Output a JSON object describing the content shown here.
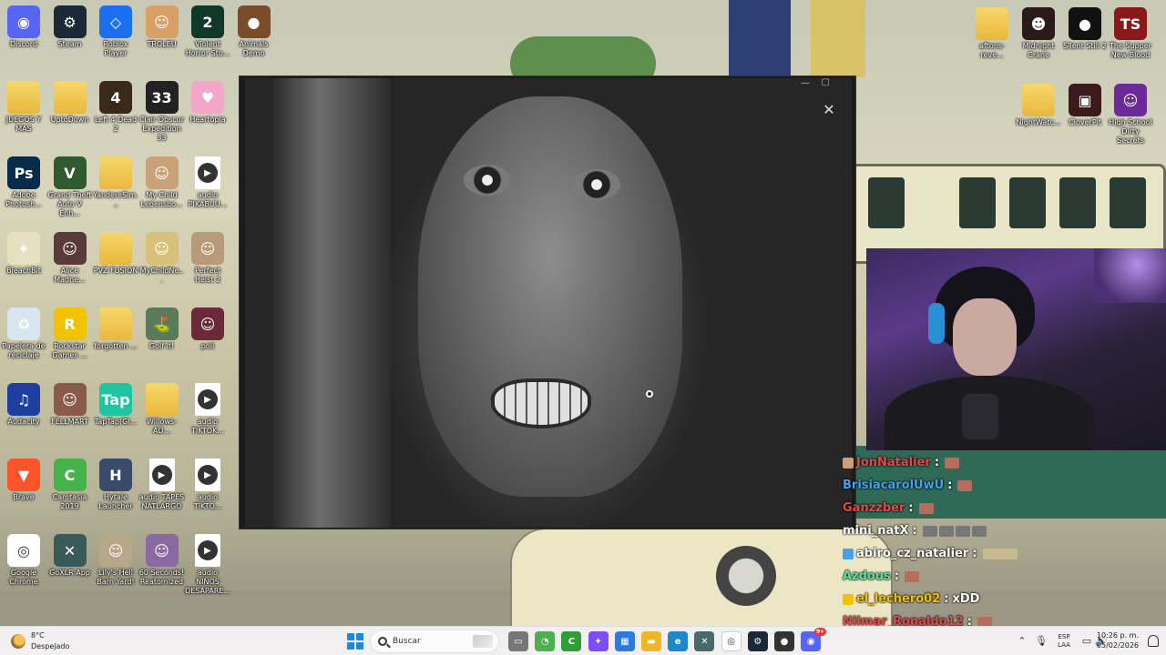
{
  "desktop": {
    "icons_left": [
      {
        "label": "Discord",
        "icon": "discord-icon",
        "color": "#5865f2",
        "glyph": "◉"
      },
      {
        "label": "Steam",
        "icon": "steam-icon",
        "color": "#1b2838",
        "glyph": "⚙"
      },
      {
        "label": "Roblox Player",
        "icon": "roblox-icon",
        "color": "#1d6ff2",
        "glyph": "◇"
      },
      {
        "label": "TROLEU",
        "icon": "troll-face-icon",
        "color": "#d9a066",
        "glyph": "☺"
      },
      {
        "label": "Violent Horror Sto...",
        "icon": "violent-horror-icon",
        "color": "#0f3a2a",
        "glyph": "2"
      },
      {
        "label": "Animals Demo",
        "icon": "animals-demo-icon",
        "color": "#7a4d2a",
        "glyph": "●"
      },
      {
        "label": "JUEGOS Y MAS",
        "icon": "folder-icon",
        "color": "#f0c24a",
        "glyph": ""
      },
      {
        "label": "UptoDown",
        "icon": "folder-icon",
        "color": "#f0c24a",
        "glyph": ""
      },
      {
        "label": "Left 4 Dead 2",
        "icon": "left4dead-icon",
        "color": "#3a2a1a",
        "glyph": "4"
      },
      {
        "label": "Clair Obscur Expedition 33",
        "icon": "expedition33-icon",
        "color": "#222222",
        "glyph": "33"
      },
      {
        "label": "Heartopia",
        "icon": "heartopia-icon",
        "color": "#f2a6c8",
        "glyph": "♥"
      },
      {
        "label": "Adobe Photosh...",
        "icon": "photoshop-icon",
        "color": "#0a2a4a",
        "glyph": "Ps"
      },
      {
        "label": "Grand Theft Auto V Enh...",
        "icon": "gta-icon",
        "color": "#2f5a2f",
        "glyph": "V"
      },
      {
        "label": "YandereSim...",
        "icon": "folder-icon",
        "color": "#f0c24a",
        "glyph": ""
      },
      {
        "label": "My Child Lebensbo...",
        "icon": "mychild-icon",
        "color": "#c9a27a",
        "glyph": "☺"
      },
      {
        "label": "audio PIKABUU...",
        "icon": "audio-file-icon",
        "color": "#ffffff",
        "glyph": "▶"
      },
      {
        "label": "BleachBit",
        "icon": "bleachbit-icon",
        "color": "#e6e0c0",
        "glyph": "✦"
      },
      {
        "label": "Alice Madne...",
        "icon": "alice-icon",
        "color": "#5a3a3a",
        "glyph": "☺"
      },
      {
        "label": "PVZ FUSION",
        "icon": "folder-icon",
        "color": "#f0c24a",
        "glyph": ""
      },
      {
        "label": "MyChildNe...",
        "icon": "mychildnew-icon",
        "color": "#d9c07a",
        "glyph": "☺"
      },
      {
        "label": "Perfect Heist 2",
        "icon": "perfect-heist-icon",
        "color": "#b89a7a",
        "glyph": "☺"
      },
      {
        "label": "Papelera de reciclaje",
        "icon": "recycle-bin-icon",
        "color": "#d8e6ef",
        "glyph": "♻"
      },
      {
        "label": "Rockstar Games ...",
        "icon": "rockstar-icon",
        "color": "#f2c200",
        "glyph": "R"
      },
      {
        "label": "forgotten ...",
        "icon": "folder-icon",
        "color": "#f0c24a",
        "glyph": ""
      },
      {
        "label": "Golf it!",
        "icon": "golf-it-icon",
        "color": "#5a7a5a",
        "glyph": "⛳"
      },
      {
        "label": "poli",
        "icon": "poli-icon",
        "color": "#6a2a3a",
        "glyph": "☺"
      },
      {
        "label": "Audacity",
        "icon": "audacity-icon",
        "color": "#1e3fa0",
        "glyph": "♫"
      },
      {
        "label": "FELLMART",
        "icon": "fellmart-icon",
        "color": "#8a5a4a",
        "glyph": "☺"
      },
      {
        "label": "TapTap(Gl...",
        "icon": "taptap-icon",
        "color": "#1bc6a0",
        "glyph": "Tap"
      },
      {
        "label": "Willows-AD...",
        "icon": "folder-icon",
        "color": "#f0c24a",
        "glyph": ""
      },
      {
        "label": "audio TIKTOK...",
        "icon": "audio-file-icon",
        "color": "#ffffff",
        "glyph": "▶"
      },
      {
        "label": "Brave",
        "icon": "brave-icon",
        "color": "#fb542b",
        "glyph": "▼"
      },
      {
        "label": "Camtasia 2019",
        "icon": "camtasia-icon",
        "color": "#45b24a",
        "glyph": "C"
      },
      {
        "label": "Hytale Launcher",
        "icon": "hytale-icon",
        "color": "#3a4a6a",
        "glyph": "H"
      },
      {
        "label": "audio TAPES NATLARGO",
        "icon": "audio-file-icon",
        "color": "#ffffff",
        "glyph": "▶"
      },
      {
        "label": "audio TIKTO...",
        "icon": "audio-file-icon",
        "color": "#ffffff",
        "glyph": "▶"
      },
      {
        "label": "Google Chrome",
        "icon": "chrome-icon",
        "color": "#ffffff",
        "glyph": "◎"
      },
      {
        "label": "GoXLR App",
        "icon": "goxlr-icon",
        "color": "#3a5a5a",
        "glyph": "✕"
      },
      {
        "label": "Lily's Hell Barn Yard!",
        "icon": "lily-hell-barn-icon",
        "color": "#b8a88a",
        "glyph": "☺"
      },
      {
        "label": "60 Seconds! Reatomized",
        "icon": "sixty-seconds-icon",
        "color": "#8a6aa0",
        "glyph": "☺"
      },
      {
        "label": "audio NIÑOS DESAPARE...",
        "icon": "audio-file-icon",
        "color": "#ffffff",
        "glyph": "▶"
      }
    ],
    "icons_right": [
      {
        "label": "aftons-reve...",
        "icon": "folder-icon",
        "color": "#f0c24a",
        "glyph": ""
      },
      {
        "label": "Midnight Crane",
        "icon": "midnight-crane-icon",
        "color": "#2a1a1a",
        "glyph": "☻"
      },
      {
        "label": "Silent Still 2",
        "icon": "silent-still-icon",
        "color": "#111111",
        "glyph": "●"
      },
      {
        "label": "The Supper New Blood",
        "icon": "the-supper-icon",
        "color": "#8a1a1a",
        "glyph": "TS"
      },
      {
        "label": "NightWatc...",
        "icon": "folder-icon",
        "color": "#f0c24a",
        "glyph": ""
      },
      {
        "label": "CloverPit",
        "icon": "cloverpit-icon",
        "color": "#3a1a1a",
        "glyph": "▣"
      },
      {
        "label": "High School Dirty Secrets",
        "icon": "high-school-icon",
        "color": "#6a2a9a",
        "glyph": "☺"
      }
    ]
  },
  "chat": [
    {
      "name": "JonNatalier",
      "name_color": "#e24a4a",
      "badge": "#c9a07a",
      "message": "",
      "emotes": 1
    },
    {
      "name": "BrisiacarolUwU",
      "name_color": "#4aa0e6",
      "badge": "",
      "message": "",
      "emotes": 1
    },
    {
      "name": "Ganzzber",
      "name_color": "#e24a4a",
      "badge": "",
      "message": "",
      "emotes": 1
    },
    {
      "name": "mini_natX",
      "name_color": "#ffffff",
      "badge": "",
      "message": "",
      "emotes": 4
    },
    {
      "name": "abiro_cz_natalier",
      "name_color": "#ffffff",
      "badge": "#4aa0e6",
      "message": "",
      "emotes": 1
    },
    {
      "name": "Azdous",
      "name_color": "#5ee0a0",
      "badge": "",
      "message": "",
      "emotes": 1
    },
    {
      "name": "el_lechero02",
      "name_color": "#f2c200",
      "badge": "#f2c200",
      "message": "xDD",
      "emotes": 0
    },
    {
      "name": "Nilmar_Ronaldo12",
      "name_color": "#e24a4a",
      "badge": "",
      "message": "",
      "emotes": 1
    }
  ],
  "taskbar": {
    "weather_temp": "8°C",
    "weather_desc": "Despejado",
    "search_placeholder": "Buscar",
    "language_top": "ESP",
    "language_bottom": "LAA",
    "time": "10:26 p. m.",
    "date": "05/02/2026",
    "discord_badge": "9+",
    "apps": [
      {
        "name": "file-icon",
        "color": "#777777",
        "glyph": "▭"
      },
      {
        "name": "app-green-icon",
        "color": "#4caf50",
        "glyph": "◔"
      },
      {
        "name": "camtasia-icon",
        "color": "#2e9d3a",
        "glyph": "C"
      },
      {
        "name": "copilot-icon",
        "color": "#7c4dff",
        "glyph": "✦"
      },
      {
        "name": "store-icon",
        "color": "#2a7ae2",
        "glyph": "▦"
      },
      {
        "name": "file-explorer-icon",
        "color": "#f0b62a",
        "glyph": "▬"
      },
      {
        "name": "edge-icon",
        "color": "#1e88c7",
        "glyph": "e"
      },
      {
        "name": "goxlr-icon",
        "color": "#4a6a6a",
        "glyph": "✕"
      },
      {
        "name": "chrome-icon",
        "color": "#ffffff",
        "glyph": "◎"
      },
      {
        "name": "steam-icon",
        "color": "#1b2838",
        "glyph": "⚙"
      },
      {
        "name": "obs-icon",
        "color": "#333333",
        "glyph": "●"
      },
      {
        "name": "discord-icon",
        "color": "#5865f2",
        "glyph": "◉"
      }
    ]
  }
}
